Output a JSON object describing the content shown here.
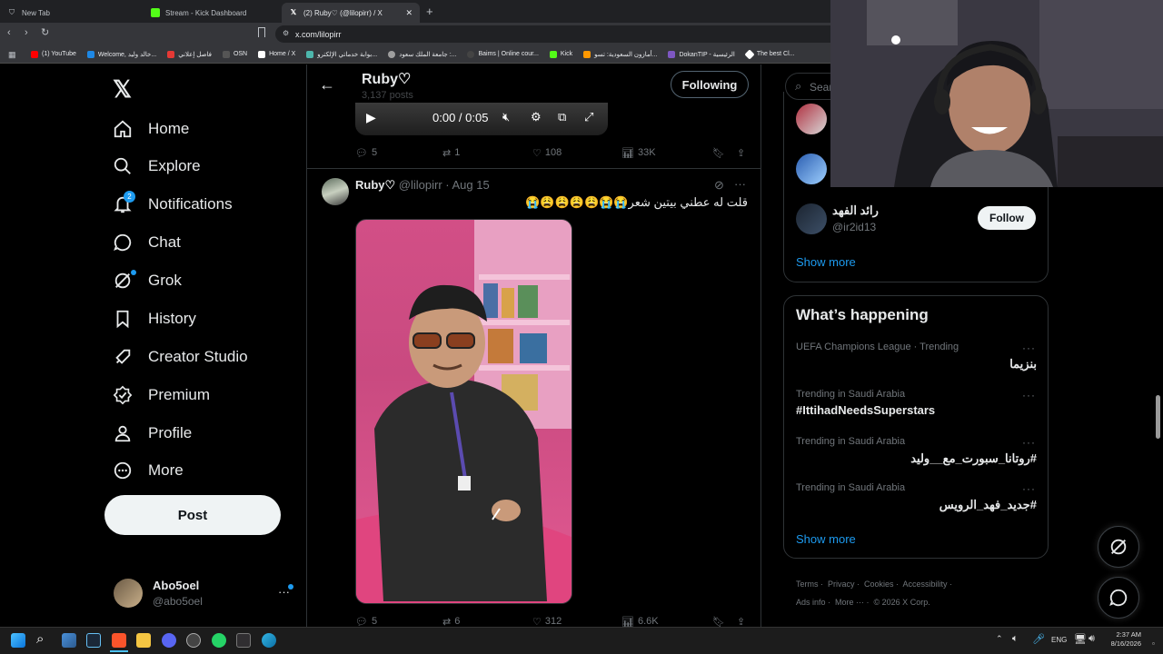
{
  "browser": {
    "tabs": [
      {
        "title": "New Tab"
      },
      {
        "title": "Stream - Kick Dashboard"
      },
      {
        "title": "(2) Ruby♡ (@lilopirr) / X"
      }
    ],
    "new_tab_label": "+",
    "url": "x.com/lilopirr",
    "bookmarks": [
      {
        "label": "(1) YouTube",
        "color": "#ff0000"
      },
      {
        "label": "Welcome, خالد وليد...",
        "color": "#1e88e5"
      },
      {
        "label": "فاصل إعلاني",
        "color": "#e53935"
      },
      {
        "label": "OSN",
        "color": "#333333"
      },
      {
        "label": "Home / X",
        "color": "#ffffff"
      },
      {
        "label": "بوابة خدماتي الإلكترو...",
        "color": "#4db6ac"
      },
      {
        "label": "جامعة الملك سعود :...",
        "color": "#9e9e9e"
      },
      {
        "label": "Baims | Online cour...",
        "color": "#212121"
      },
      {
        "label": "Kick",
        "color": "#53fc18"
      },
      {
        "label": "أمازون السعودية: تسو...",
        "color": "#ff9800"
      },
      {
        "label": "DokanTIP - الرئيسية",
        "color": "#7e57c2"
      },
      {
        "label": "The best Cl...",
        "color": "#ffffff"
      }
    ]
  },
  "sidebar": {
    "items": [
      {
        "label": "Home",
        "icon": "home-icon"
      },
      {
        "label": "Explore",
        "icon": "search-icon"
      },
      {
        "label": "Notifications",
        "icon": "bell-icon",
        "badge": "2"
      },
      {
        "label": "Chat",
        "icon": "chat-icon"
      },
      {
        "label": "Grok",
        "icon": "grok-icon"
      },
      {
        "label": "History",
        "icon": "bookmark-icon"
      },
      {
        "label": "Creator Studio",
        "icon": "rocket-icon"
      },
      {
        "label": "Premium",
        "icon": "verified-icon"
      },
      {
        "label": "Profile",
        "icon": "person-icon"
      },
      {
        "label": "More",
        "icon": "more-circle-icon"
      }
    ],
    "post_label": "Post",
    "account": {
      "name": "Abo5oel",
      "handle": "@abo5oel"
    }
  },
  "header": {
    "name": "Ruby♡",
    "posts": "3,137 posts",
    "following_label": "Following"
  },
  "video_controls": {
    "time": "0:00 / 0:05"
  },
  "tweet1_actions": {
    "replies": "5",
    "reposts": "1",
    "likes": "108",
    "views": "33K"
  },
  "tweet2": {
    "name": "Ruby♡",
    "handle": "@lilopirr",
    "date": "· Aug 15",
    "text": "قلت له عطني بيتين شعر😭😭😩😩😩😩😭",
    "actions": {
      "replies": "5",
      "reposts": "6",
      "likes": "312",
      "views": "6.6K"
    }
  },
  "right": {
    "search_placeholder": "Sear",
    "follow_suggestion": {
      "name": "رائد الفهد",
      "handle": "@ir2id13",
      "button": "Follow"
    },
    "show_more_1": "Show more",
    "whats_happening": "What’s happening",
    "trends": [
      {
        "context": "UEFA Champions League · Trending",
        "name": "بنزيما"
      },
      {
        "context": "Trending in Saudi Arabia",
        "name": "#IttihadNeedsSuperstars"
      },
      {
        "context": "Trending in Saudi Arabia",
        "name": "#روتانا_سبورت_مع__وليد"
      },
      {
        "context": "Trending in Saudi Arabia",
        "name": "#جديد_فهد_الرويس"
      }
    ],
    "show_more_2": "Show more",
    "footer": {
      "terms": "Terms",
      "privacy": "Privacy",
      "cookies": "Cookies",
      "accessibility": "Accessibility",
      "ads": "Ads info",
      "more": "More ···",
      "copyright": "© 2026 X Corp."
    }
  },
  "taskbar": {
    "lang": "ENG",
    "time": "2:37 AM",
    "date": "8/16/2026"
  }
}
